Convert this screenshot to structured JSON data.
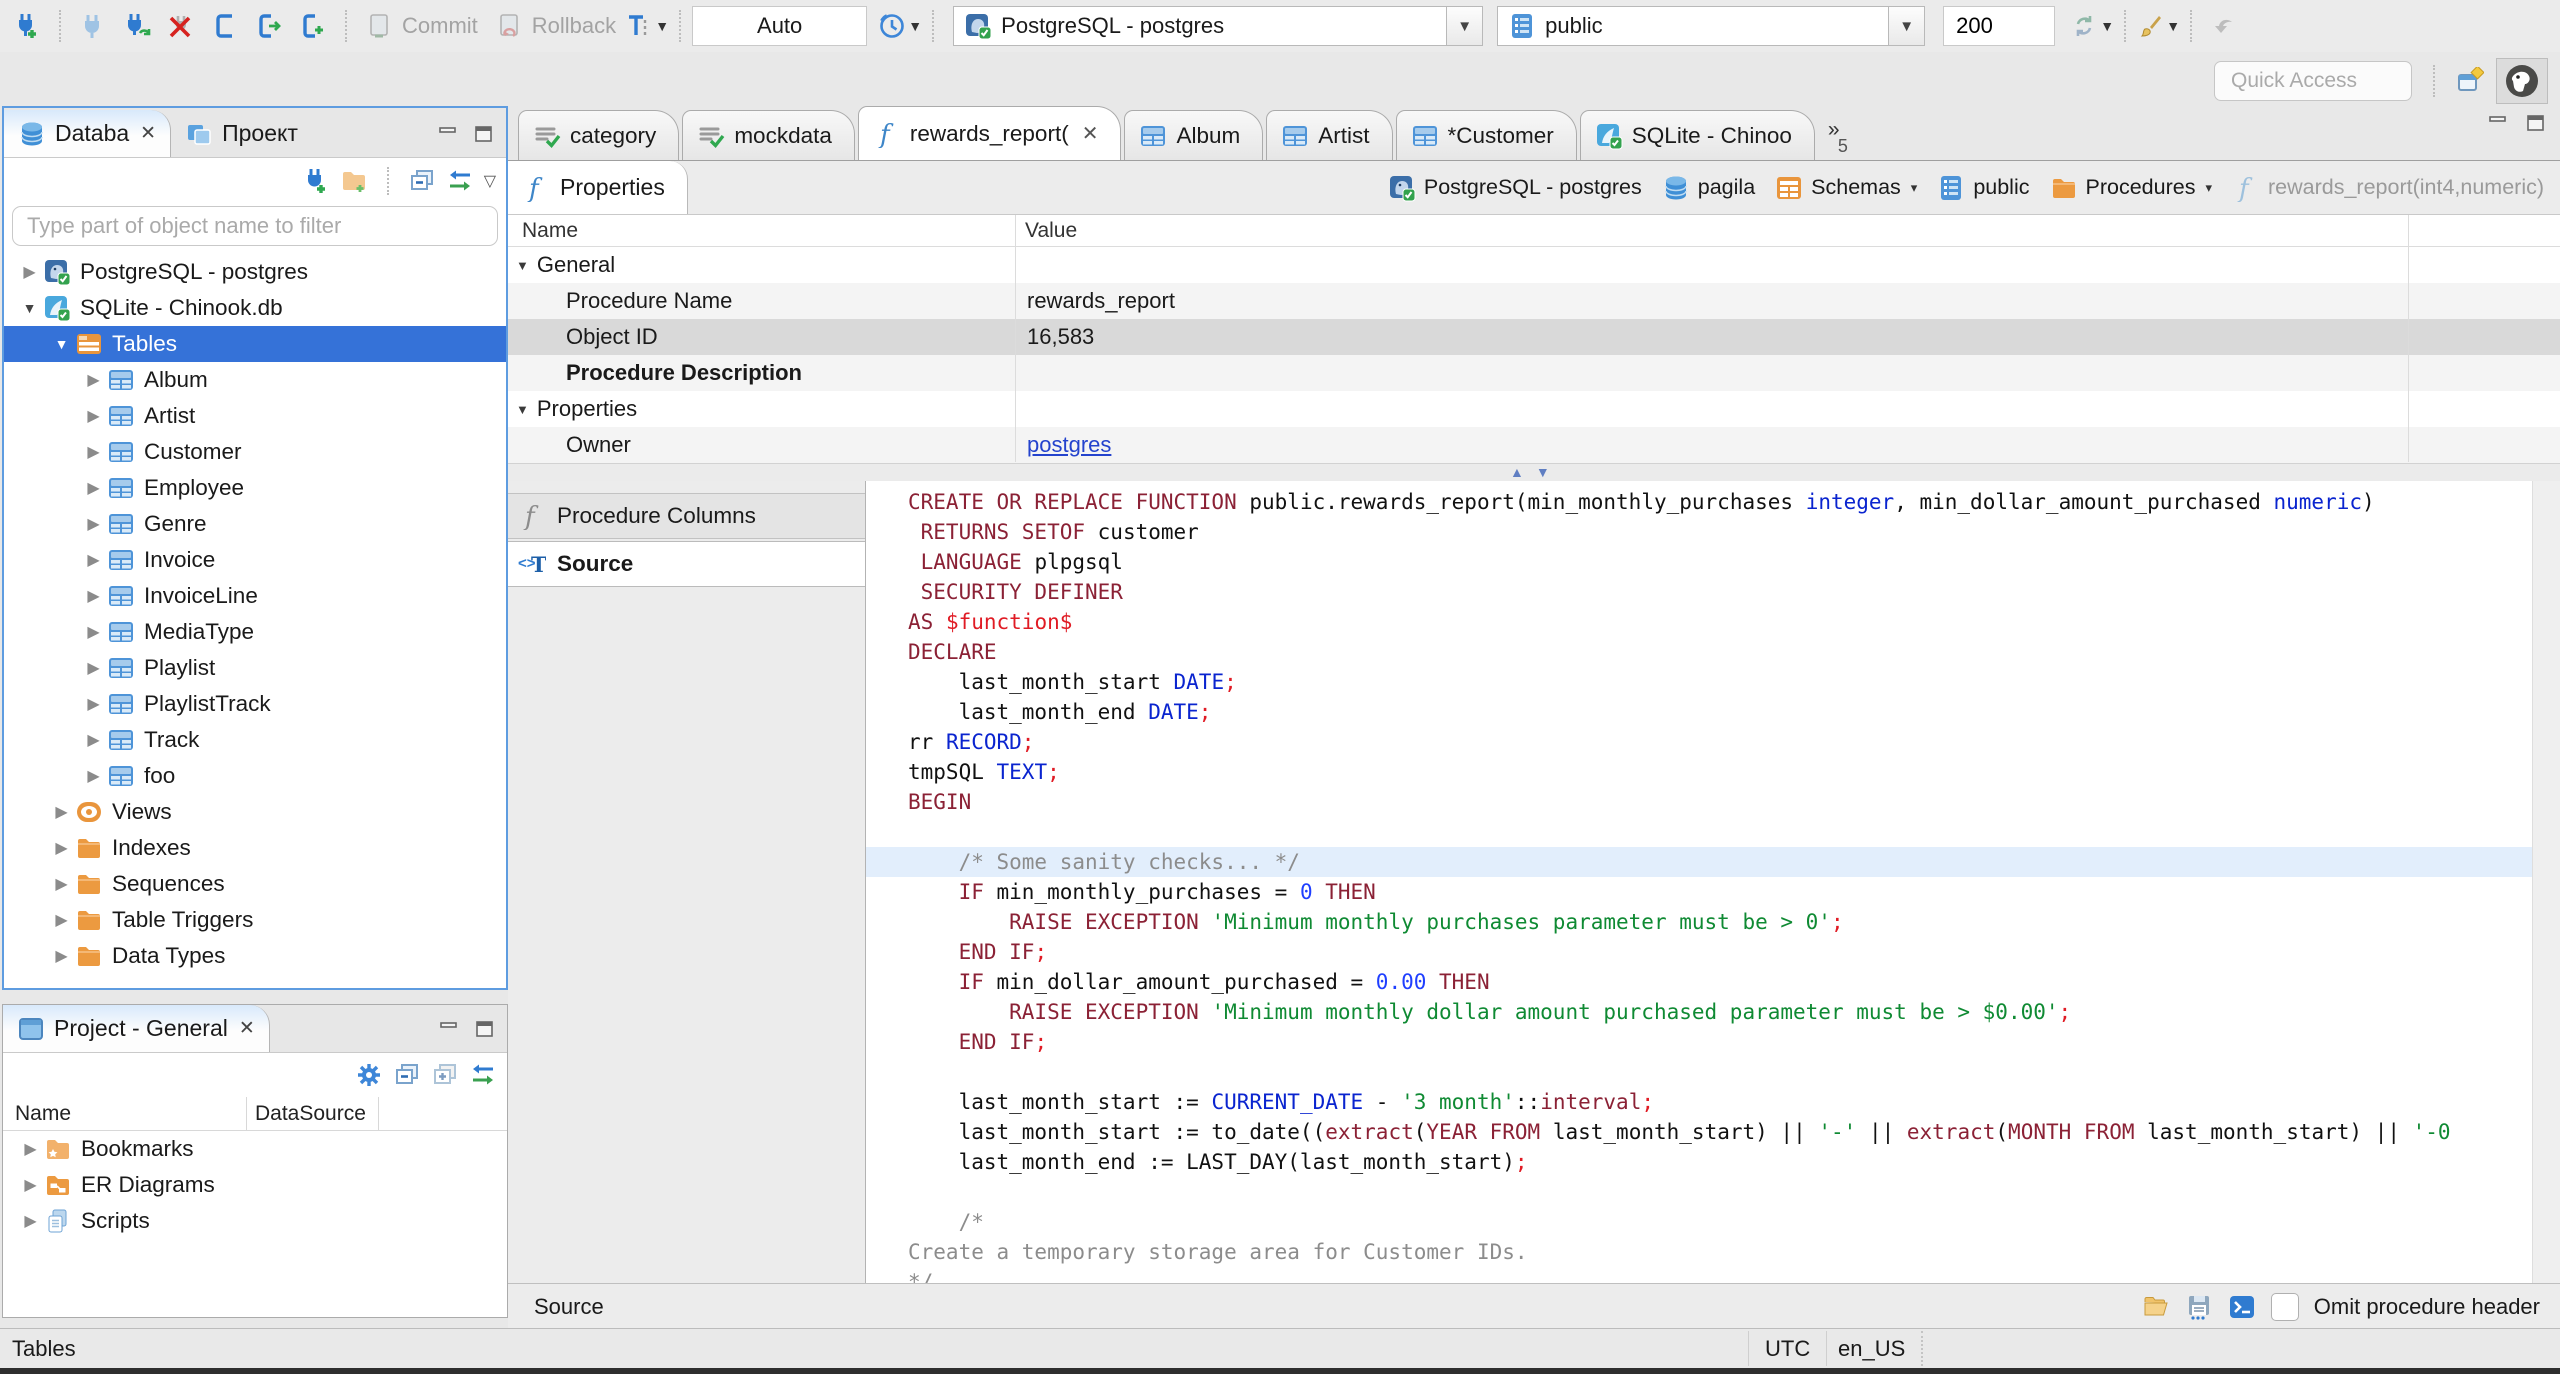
{
  "window": {
    "quick_access_placeholder": "Quick Access"
  },
  "toolbar": {
    "commit_label": "Commit",
    "rollback_label": "Rollback",
    "txn_mode": "Auto",
    "connection": "PostgreSQL - postgres",
    "schema": "public",
    "fetch_size": "200"
  },
  "navigator": {
    "tab_database_label": "Databa",
    "tab_project_label": "Проект",
    "filter_placeholder": "Type part of object name to filter",
    "tree": [
      {
        "label": "PostgreSQL - postgres",
        "icon": "postgres",
        "depth": 0,
        "expander": "collapsed"
      },
      {
        "label": "SQLite - Chinook.db",
        "icon": "sqlite",
        "depth": 0,
        "expander": "expanded"
      },
      {
        "label": "Tables",
        "icon": "tables",
        "depth": 1,
        "expander": "expanded",
        "selected": true
      },
      {
        "label": "Album",
        "icon": "table",
        "depth": 2,
        "expander": "collapsed"
      },
      {
        "label": "Artist",
        "icon": "table",
        "depth": 2,
        "expander": "collapsed"
      },
      {
        "label": "Customer",
        "icon": "table",
        "depth": 2,
        "expander": "collapsed"
      },
      {
        "label": "Employee",
        "icon": "table",
        "depth": 2,
        "expander": "collapsed"
      },
      {
        "label": "Genre",
        "icon": "table",
        "depth": 2,
        "expander": "collapsed"
      },
      {
        "label": "Invoice",
        "icon": "table",
        "depth": 2,
        "expander": "collapsed"
      },
      {
        "label": "InvoiceLine",
        "icon": "table",
        "depth": 2,
        "expander": "collapsed"
      },
      {
        "label": "MediaType",
        "icon": "table",
        "depth": 2,
        "expander": "collapsed"
      },
      {
        "label": "Playlist",
        "icon": "table",
        "depth": 2,
        "expander": "collapsed"
      },
      {
        "label": "PlaylistTrack",
        "icon": "table",
        "depth": 2,
        "expander": "collapsed"
      },
      {
        "label": "Track",
        "icon": "table",
        "depth": 2,
        "expander": "collapsed"
      },
      {
        "label": "foo",
        "icon": "table",
        "depth": 2,
        "expander": "collapsed"
      },
      {
        "label": "Views",
        "icon": "views",
        "depth": 1,
        "expander": "collapsed"
      },
      {
        "label": "Indexes",
        "icon": "folder",
        "depth": 1,
        "expander": "collapsed"
      },
      {
        "label": "Sequences",
        "icon": "folder",
        "depth": 1,
        "expander": "collapsed"
      },
      {
        "label": "Table Triggers",
        "icon": "folder",
        "depth": 1,
        "expander": "collapsed"
      },
      {
        "label": "Data Types",
        "icon": "folder",
        "depth": 1,
        "expander": "collapsed"
      }
    ]
  },
  "project_panel": {
    "title": "Project - General",
    "col_name": "Name",
    "col_datasource": "DataSource",
    "items": [
      {
        "label": "Bookmarks",
        "icon": "folder-star"
      },
      {
        "label": "ER Diagrams",
        "icon": "folder-er"
      },
      {
        "label": "Scripts",
        "icon": "scripts"
      }
    ]
  },
  "editor": {
    "tabs": [
      {
        "label": "category",
        "icon": "script"
      },
      {
        "label": "mockdata",
        "icon": "script"
      },
      {
        "label": "rewards_report(",
        "icon": "function",
        "active": true,
        "closable": true
      },
      {
        "label": "Album",
        "icon": "table"
      },
      {
        "label": "Artist",
        "icon": "table"
      },
      {
        "label": "*Customer",
        "icon": "table"
      },
      {
        "label": "SQLite - Chinoo",
        "icon": "sqlite"
      }
    ],
    "overflow_count": "5",
    "properties_tab_label": "Properties",
    "breadcrumb": [
      {
        "label": "PostgreSQL - postgres",
        "icon": "postgres"
      },
      {
        "label": "pagila",
        "icon": "database"
      },
      {
        "label": "Schemas",
        "icon": "schemas",
        "dropdown": true
      },
      {
        "label": "public",
        "icon": "schema"
      },
      {
        "label": "Procedures",
        "icon": "folder",
        "dropdown": true
      },
      {
        "label": "rewards_report(int4,numeric)",
        "icon": "function",
        "muted": true
      }
    ],
    "grid": {
      "col_name": "Name",
      "col_value": "Value",
      "rows": [
        {
          "kind": "group",
          "name": "General",
          "value": ""
        },
        {
          "kind": "row",
          "name": "Procedure Name",
          "value": "rewards_report"
        },
        {
          "kind": "row",
          "name": "Object ID",
          "value": "16,583",
          "selected": true
        },
        {
          "kind": "row",
          "name": "Procedure Description",
          "value": "",
          "bold": true
        },
        {
          "kind": "group",
          "name": "Properties",
          "value": ""
        },
        {
          "kind": "row",
          "name": "Owner",
          "value": "postgres",
          "link": true
        }
      ]
    },
    "subtab_procedure_columns": "Procedure Columns",
    "subtab_source": "Source",
    "status_label": "Source",
    "omit_checkbox_label": "Omit procedure header"
  },
  "status_bar": {
    "left": "Tables",
    "timezone": "UTC",
    "locale": "en_US"
  },
  "code": {
    "highlight_line": 12,
    "lines": [
      [
        [
          "kw",
          "CREATE OR REPLACE FUNCTION"
        ],
        [
          "id",
          " public.rewards_report(min_monthly_purchases "
        ],
        [
          "typ",
          "integer"
        ],
        [
          "id",
          ", min_dollar_amount_purchased "
        ],
        [
          "typ",
          "numeric"
        ],
        [
          "id",
          ")"
        ]
      ],
      [
        [
          "kw",
          " RETURNS SETOF"
        ],
        [
          "id",
          " customer"
        ]
      ],
      [
        [
          "kw",
          " LANGUAGE"
        ],
        [
          "id",
          " plpgsql"
        ]
      ],
      [
        [
          "kw",
          " SECURITY DEFINER"
        ]
      ],
      [
        [
          "kw",
          "AS"
        ],
        [
          "red",
          " $function$"
        ]
      ],
      [
        [
          "kw",
          "DECLARE"
        ]
      ],
      [
        [
          "id",
          "    last_month_start "
        ],
        [
          "typ",
          "DATE"
        ],
        [
          "red",
          ";"
        ]
      ],
      [
        [
          "id",
          "    last_month_end "
        ],
        [
          "typ",
          "DATE"
        ],
        [
          "red",
          ";"
        ]
      ],
      [
        [
          "id",
          "rr "
        ],
        [
          "typ",
          "RECORD"
        ],
        [
          "red",
          ";"
        ]
      ],
      [
        [
          "id",
          "tmpSQL "
        ],
        [
          "typ",
          "TEXT"
        ],
        [
          "red",
          ";"
        ]
      ],
      [
        [
          "kw",
          "BEGIN"
        ]
      ],
      [],
      [
        [
          "com",
          "    /* Some sanity checks... */"
        ]
      ],
      [
        [
          "kw",
          "    IF"
        ],
        [
          "id",
          " min_monthly_purchases = "
        ],
        [
          "num",
          "0"
        ],
        [
          "kw",
          " THEN"
        ]
      ],
      [
        [
          "kw",
          "        RAISE EXCEPTION "
        ],
        [
          "str",
          "'Minimum monthly purchases parameter must be > 0'"
        ],
        [
          "red",
          ";"
        ]
      ],
      [
        [
          "kw",
          "    END IF"
        ],
        [
          "red",
          ";"
        ]
      ],
      [
        [
          "kw",
          "    IF"
        ],
        [
          "id",
          " min_dollar_amount_purchased = "
        ],
        [
          "num",
          "0.00"
        ],
        [
          "kw",
          " THEN"
        ]
      ],
      [
        [
          "kw",
          "        RAISE EXCEPTION "
        ],
        [
          "str",
          "'Minimum monthly dollar amount purchased parameter must be > $0.00'"
        ],
        [
          "red",
          ";"
        ]
      ],
      [
        [
          "kw",
          "    END IF"
        ],
        [
          "red",
          ";"
        ]
      ],
      [],
      [
        [
          "id",
          "    last_month_start := "
        ],
        [
          "typ",
          "CURRENT_DATE"
        ],
        [
          "id",
          " - "
        ],
        [
          "str",
          "'3 month'"
        ],
        [
          "id",
          "::"
        ],
        [
          "kw",
          "interval"
        ],
        [
          "red",
          ";"
        ]
      ],
      [
        [
          "id",
          "    last_month_start := to_date(("
        ],
        [
          "kw",
          "extract"
        ],
        [
          "id",
          "("
        ],
        [
          "kw",
          "YEAR FROM"
        ],
        [
          "id",
          " last_month_start) || "
        ],
        [
          "str",
          "'-'"
        ],
        [
          "id",
          " || "
        ],
        [
          "kw",
          "extract"
        ],
        [
          "id",
          "("
        ],
        [
          "kw",
          "MONTH FROM"
        ],
        [
          "id",
          " last_month_start) || "
        ],
        [
          "str",
          "'-0"
        ]
      ],
      [
        [
          "id",
          "    last_month_end := LAST_DAY(last_month_start)"
        ],
        [
          "red",
          ";"
        ]
      ],
      [],
      [
        [
          "com",
          "    /*"
        ]
      ],
      [
        [
          "com",
          "Create a temporary storage area for Customer IDs."
        ]
      ],
      [
        [
          "com",
          "*/"
        ]
      ]
    ]
  }
}
